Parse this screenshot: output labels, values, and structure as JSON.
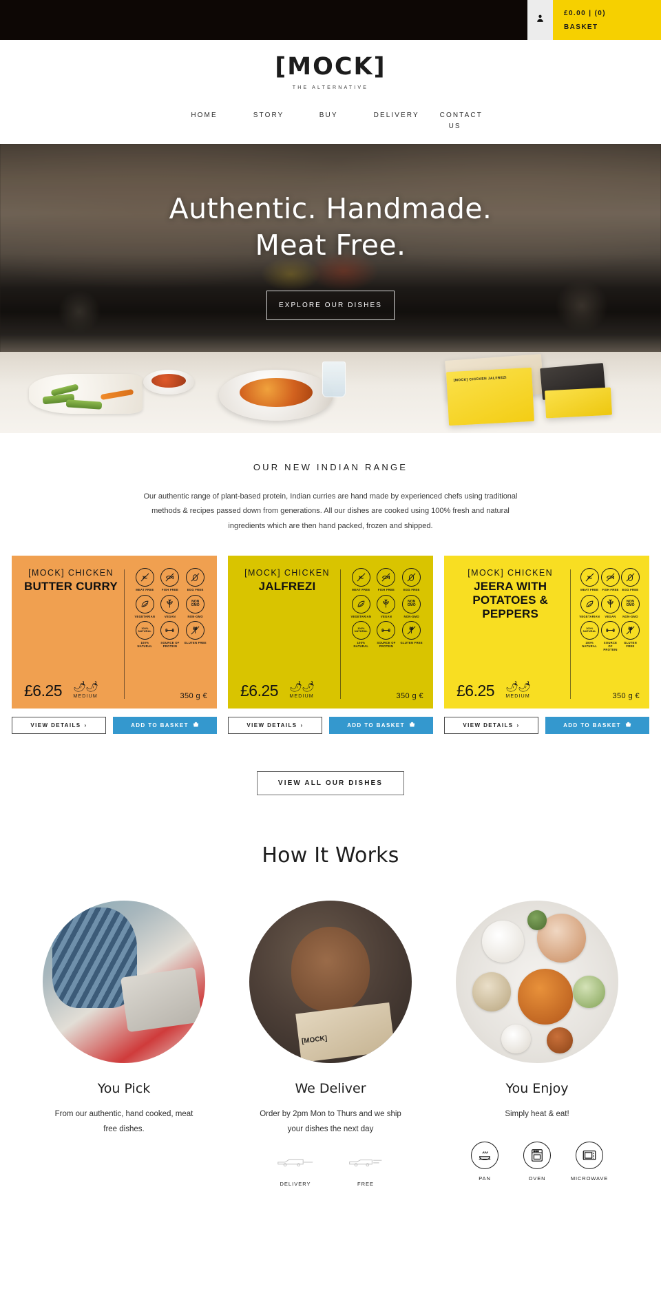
{
  "topbar": {
    "account_icon": "user-icon",
    "basket_total": "£0.00 | (0)",
    "basket_label": "BASKET",
    "basket_bg": "#f6d000",
    "bar_bg": "#0d0705"
  },
  "header": {
    "logo_text": "[MOCK]",
    "logo_tagline": "THE ALTERNATIVE"
  },
  "nav": {
    "items": [
      {
        "label": "HOME"
      },
      {
        "label": "STORY"
      },
      {
        "label": "BUY"
      },
      {
        "label": "DELIVERY"
      },
      {
        "label": "CONTACT US"
      }
    ]
  },
  "hero": {
    "title_line1": "Authentic. Handmade.",
    "title_line2": "Meat Free.",
    "cta_label": "EXPLORE OUR DISHES",
    "pack_label": "[MOCK] CHICKEN JALFREZI",
    "pack_brand": "[MOCK]"
  },
  "range": {
    "title": "OUR NEW INDIAN RANGE",
    "description": "Our authentic range of plant-based protein, Indian curries are hand made by experienced chefs using traditional methods & recipes passed down from generations. All our dishes are cooked using 100% fresh and natural ingredients which are then hand packed, frozen and shipped.",
    "view_all_label": "VIEW ALL OUR DISHES"
  },
  "products": {
    "details_label": "VIEW DETAILS",
    "details_chevron": "›",
    "basket_label": "ADD TO BASKET",
    "basket_icon": "basket-icon",
    "badges": [
      {
        "id": "meat-free",
        "label": "MEAT FREE",
        "icon": "meat-free-icon"
      },
      {
        "id": "fish-free",
        "label": "FISH FREE",
        "icon": "fish-free-icon"
      },
      {
        "id": "egg-free",
        "label": "EGG FREE",
        "icon": "egg-free-icon"
      },
      {
        "id": "vegetarian",
        "label": "VEGETARIAN",
        "icon": "leaf-icon"
      },
      {
        "id": "vegan",
        "label": "VEGAN",
        "icon": "plant-icon"
      },
      {
        "id": "non-gmo",
        "label": "NON-GMO",
        "icon": "non-gmo-text"
      },
      {
        "id": "natural",
        "label": "100% NATURAL",
        "icon": "natural-text"
      },
      {
        "id": "protein",
        "label": "SOURCE OF PROTEIN",
        "icon": "dumbbell-icon"
      },
      {
        "id": "gluten-free",
        "label": "GLUTEN FREE",
        "icon": "gluten-free-icon"
      }
    ],
    "badge_text": {
      "non_gmo": "NON GMO",
      "natural": "100% NATURAL"
    },
    "items": [
      {
        "kicker": "[MOCK] CHICKEN",
        "name": "BUTTER CURRY",
        "price": "£6.25",
        "heat_label": "MEDIUM",
        "heat_level": 2,
        "weight": "350 g €",
        "bg": "#f0a050"
      },
      {
        "kicker": "[MOCK] CHICKEN",
        "name": "JALFREZI",
        "price": "£6.25",
        "heat_label": "MEDIUM",
        "heat_level": 2,
        "weight": "350 g €",
        "bg": "#d9c400"
      },
      {
        "kicker": "[MOCK] CHICKEN",
        "name": "JEERA WITH POTATOES & PEPPERS",
        "price": "£6.25",
        "heat_label": "MEDIUM",
        "heat_level": 2,
        "weight": "350 g €",
        "bg": "#f8de22"
      }
    ]
  },
  "how_it_works": {
    "title": "How It Works",
    "steps": [
      {
        "name": "You Pick",
        "description": "From our authentic, hand cooked, meat free dishes.",
        "image": "person-with-laptop-photo"
      },
      {
        "name": "We Deliver",
        "description": "Order by 2pm Mon to Thurs and we ship your dishes the next day",
        "image": "woman-holding-box-photo",
        "box_brand": "[MOCK]",
        "delivery_icons": [
          {
            "label": "DELIVERY",
            "icon": "delivery-van-icon"
          },
          {
            "label": "FREE",
            "icon": "free-van-icon"
          }
        ]
      },
      {
        "name": "You Enjoy",
        "description": "Simply heat & eat!",
        "image": "indian-dishes-table-photo",
        "cook_methods": [
          {
            "label": "PAN",
            "icon": "pan-icon"
          },
          {
            "label": "OVEN",
            "icon": "oven-icon"
          },
          {
            "label": "MICROWAVE",
            "icon": "microwave-icon"
          }
        ]
      }
    ]
  }
}
